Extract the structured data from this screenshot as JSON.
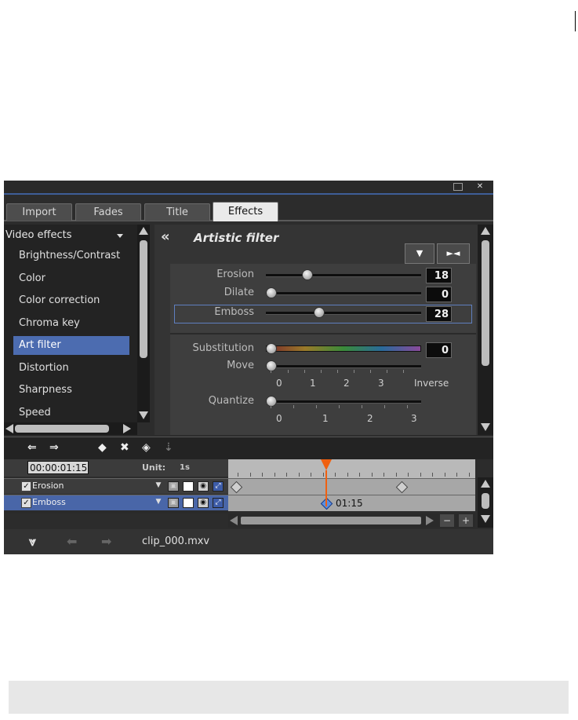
{
  "window": {
    "maximize_icon": "maximize-icon",
    "close_glyph": "✕"
  },
  "tabs": [
    {
      "label": "Import"
    },
    {
      "label": "Fades"
    },
    {
      "label": "Title"
    },
    {
      "label": "Effects",
      "active": true
    }
  ],
  "effects_list": {
    "header": "Video effects",
    "items": [
      {
        "label": "Brightness/Contrast"
      },
      {
        "label": "Color"
      },
      {
        "label": "Color correction"
      },
      {
        "label": "Chroma key"
      },
      {
        "label": "Art filter",
        "selected": true
      },
      {
        "label": "Distortion"
      },
      {
        "label": "Sharpness"
      },
      {
        "label": "Speed"
      }
    ]
  },
  "panel": {
    "back_glyph": "«",
    "title": "Artistic filter",
    "down_button_glyph": "▼",
    "reset_button_glyph": "►◄"
  },
  "params": [
    {
      "label": "Erosion",
      "value": "18",
      "fraction": 0.24
    },
    {
      "label": "Dilate",
      "value": "0",
      "fraction": 0.0
    },
    {
      "label": "Emboss",
      "value": "28",
      "fraction": 0.32
    }
  ],
  "params2": {
    "substitution": {
      "label": "Substitution",
      "value": "0",
      "fraction": 0.0
    },
    "move": {
      "label": "Move",
      "fraction": 0.0,
      "ticks": [
        "0",
        "1",
        "2",
        "3",
        "Inverse"
      ]
    },
    "quantize": {
      "label": "Quantize",
      "fraction": 0.0,
      "ticks": [
        "0",
        "1",
        "2",
        "3"
      ]
    }
  },
  "toolbar": {
    "icons": [
      "prev-keyframe-icon",
      "next-keyframe-icon",
      "add-keyframe-icon",
      "delete-keyframe-icon",
      "copy-keyframe-icon",
      "paste-keyframe-icon"
    ]
  },
  "timeline": {
    "timecode": "00:00:01:15",
    "unit_label": "Unit:",
    "unit_value": "1s",
    "tracks": [
      {
        "name": "Erosion",
        "selected": false
      },
      {
        "name": "Emboss",
        "selected": true
      }
    ],
    "keyframe_label": "01:15",
    "zoom_minus": "−",
    "zoom_plus": "+"
  },
  "statusbar": {
    "collapse_glyph": "⩔",
    "filename": "clip_000.mxv"
  }
}
